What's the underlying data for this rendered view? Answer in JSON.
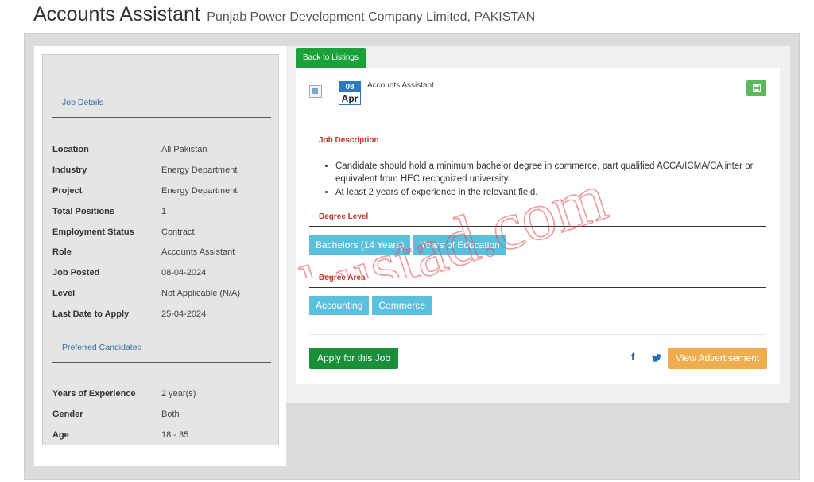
{
  "header": {
    "job_title": "Accounts Assistant",
    "company": "Punjab Power Development Company Limited, PAKISTAN"
  },
  "sidebar": {
    "job_details_heading": "Job Details",
    "details": [
      {
        "label": "Location",
        "value": "All Pakistan"
      },
      {
        "label": "Industry",
        "value": "Energy Department"
      },
      {
        "label": "Project",
        "value": "Energy Department"
      },
      {
        "label": "Total Positions",
        "value": "1"
      },
      {
        "label": "Employment Status",
        "value": "Contract"
      },
      {
        "label": "Role",
        "value": "Accounts Assistant"
      },
      {
        "label": "Job Posted",
        "value": "08-04-2024"
      },
      {
        "label": "Level",
        "value": "Not Applicable (N/A)"
      },
      {
        "label": "Last Date to Apply",
        "value": "25-04-2024"
      }
    ],
    "preferred_heading": "Preferred Candidates",
    "preferred": [
      {
        "label": "Years of Experience",
        "value": "2 year(s)"
      },
      {
        "label": "Gender",
        "value": "Both"
      },
      {
        "label": "Age",
        "value": "18 - 35"
      }
    ]
  },
  "main": {
    "back_label": "Back to Listings",
    "date": {
      "day": "08",
      "month": "Apr"
    },
    "job_name": "Accounts Assistant",
    "description_heading": "Job Description",
    "description": [
      "Candidate should hold a minimum bachelor degree in commerce, part qualified ACCA/ICMA/CA inter or equivalent from HEC recognized university.",
      "At least 2 years of experience in the relevant field."
    ],
    "degree_level_heading": "Degree Level",
    "degree_levels": [
      "Bachelors (14 Years)",
      "Years of Education"
    ],
    "degree_area_heading": "Degree Area",
    "degree_areas": [
      "Accounting",
      "Commerce"
    ],
    "apply_label": "Apply for this Job",
    "facebook_glyph": "f",
    "view_ad_label": "View Advertisement"
  },
  "watermark": "Jobustad.com",
  "colors": {
    "green": "#1aa138",
    "blue_badge": "#2b79c2",
    "tag_blue": "#5bc0de",
    "orange": "#f0ad4e",
    "section_red": "#c0392b",
    "watermark_red": "#e8474a"
  },
  "icons": {
    "save": "floppy-disk-icon",
    "facebook": "facebook-icon",
    "twitter": "twitter-icon",
    "image": "broken-image-icon"
  }
}
